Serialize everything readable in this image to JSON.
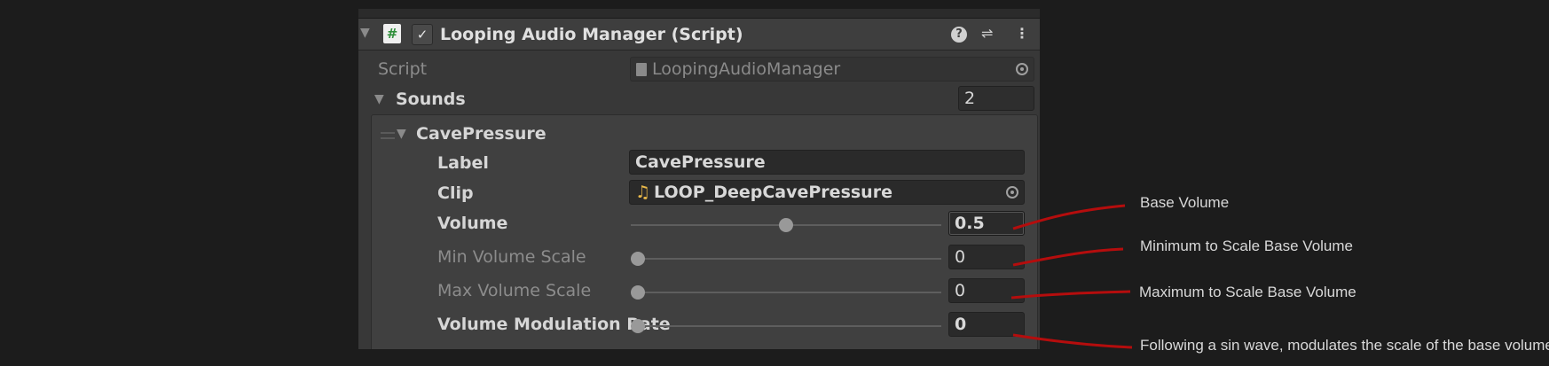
{
  "component": {
    "title": "Looping Audio Manager (Script)",
    "script_icon": "#",
    "enabled_check": "✓",
    "help_icon": "?",
    "preset_icon": "⇌",
    "menu_icon": "⋮"
  },
  "script_row": {
    "label": "Script",
    "value": "LoopingAudioManager"
  },
  "sounds": {
    "label": "Sounds",
    "count": "2"
  },
  "element": {
    "name": "CavePressure",
    "label_field": {
      "label": "Label",
      "value": "CavePressure"
    },
    "clip_field": {
      "label": "Clip",
      "note_icon": "♫",
      "value": "LOOP_DeepCavePressure"
    },
    "volume": {
      "label": "Volume",
      "value": "0.5",
      "fraction": 0.5
    },
    "min_volume_scale": {
      "label": "Min Volume Scale",
      "value": "0",
      "fraction": 0
    },
    "max_volume_scale": {
      "label": "Max Volume Scale",
      "value": "0",
      "fraction": 0
    },
    "volume_modulation_rate": {
      "label": "Volume Modulation Rate",
      "value": "0",
      "fraction": 0
    }
  },
  "annotations": [
    "Base Volume",
    "Minimum to Scale Base Volume",
    "Maximum to Scale Base Volume",
    "Following a sin wave, modulates the scale of the base volume"
  ],
  "colors": {
    "background": "#1c1c1c",
    "panel": "#383838",
    "annotation_line": "#b50d0d",
    "clip_icon": "#e8b84a"
  }
}
